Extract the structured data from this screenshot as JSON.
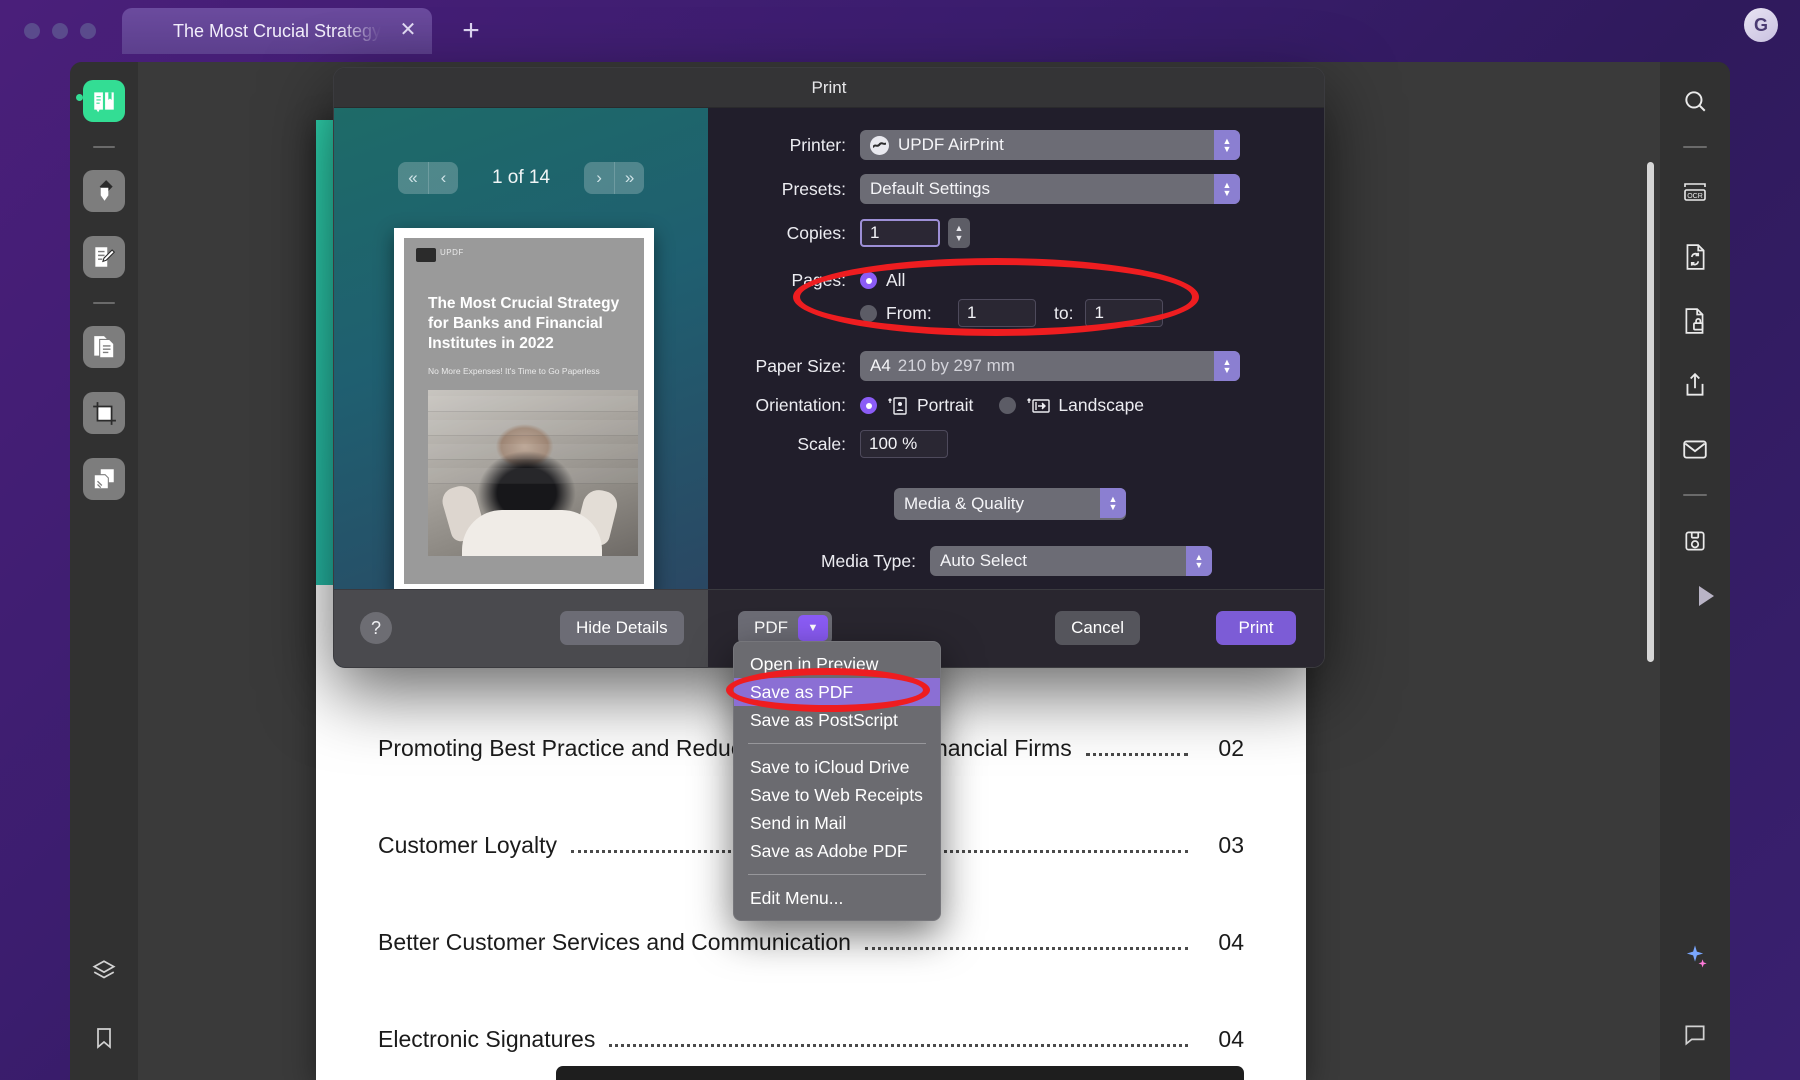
{
  "window": {
    "tab_title": "The Most Crucial Strategy",
    "close_icon": "close-icon",
    "new_tab_icon": "plus-icon",
    "avatar_initial": "G"
  },
  "left_rail": {
    "items": [
      {
        "name": "reader-tool",
        "icon": "book-reader-icon",
        "active": true
      },
      {
        "name": "highlight-tool",
        "icon": "highlighter-icon",
        "active": false
      },
      {
        "name": "edit-tool",
        "icon": "edit-document-icon",
        "active": false
      },
      {
        "name": "organize-pages-tool",
        "icon": "pages-icon",
        "active": false
      },
      {
        "name": "crop-tool",
        "icon": "crop-icon",
        "active": false
      },
      {
        "name": "batch-tool",
        "icon": "batch-pages-icon",
        "active": false
      }
    ],
    "bottom_items": [
      {
        "name": "layers-tool",
        "icon": "layers-icon"
      },
      {
        "name": "bookmark-tool",
        "icon": "bookmark-icon"
      }
    ]
  },
  "right_rail": {
    "items": [
      {
        "name": "search",
        "icon": "search-icon"
      },
      {
        "name": "ocr",
        "icon": "ocr-icon"
      },
      {
        "name": "convert",
        "icon": "convert-document-icon"
      },
      {
        "name": "protect",
        "icon": "lock-document-icon"
      },
      {
        "name": "share",
        "icon": "share-icon"
      },
      {
        "name": "mail",
        "icon": "mail-icon"
      },
      {
        "name": "save",
        "icon": "floppy-save-icon"
      }
    ],
    "bottom_items": [
      {
        "name": "ai-assistant",
        "icon": "sparkle-icon"
      },
      {
        "name": "comment",
        "icon": "comment-icon"
      }
    ],
    "expand_icon": "play-triangle-icon"
  },
  "document": {
    "hero_logo": "updf-logo-icon",
    "toc": [
      {
        "title": "Promoting Best Practice and Reducing Workload for Financial Firms",
        "page": "02"
      },
      {
        "title": "Customer Loyalty",
        "page": "03"
      },
      {
        "title": "Better Customer Services and Communication",
        "page": "04"
      },
      {
        "title": "Electronic Signatures",
        "page": "04"
      }
    ]
  },
  "print_dialog": {
    "title": "Print",
    "preview": {
      "first_icon": "«",
      "prev_icon": "‹",
      "next_icon": "›",
      "last_icon": "»",
      "page_counter": "1 of 14",
      "thumb": {
        "logo_text": "UPDF",
        "title": "The Most Crucial Strategy for Banks and Financial Institutes in 2022",
        "subtitle": "No More Expenses! It's Time to Go Paperless"
      }
    },
    "settings": {
      "printer_label": "Printer:",
      "printer_value": "UPDF AirPrint",
      "printer_icon": "airprint-icon",
      "presets_label": "Presets:",
      "presets_value": "Default Settings",
      "copies_label": "Copies:",
      "copies_value": "1",
      "pages_label": "Pages:",
      "pages_all_label": "All",
      "pages_all_selected": true,
      "pages_from_label": "From:",
      "pages_from_value": "1",
      "pages_to_label": "to:",
      "pages_to_value": "1",
      "paper_size_label": "Paper Size:",
      "paper_size_value": "A4",
      "paper_size_dimensions": "210 by 297 mm",
      "orientation_label": "Orientation:",
      "orientation_portrait_label": "Portrait",
      "orientation_landscape_label": "Landscape",
      "orientation_portrait_selected": true,
      "portrait_icon": "portrait-page-icon",
      "landscape_icon": "landscape-page-icon",
      "scale_label": "Scale:",
      "scale_value": "100 %",
      "feature_popup_value": "Media & Quality",
      "media_type_label": "Media Type:",
      "media_type_value": "Auto Select"
    },
    "footer": {
      "help_label": "?",
      "hide_details_label": "Hide Details",
      "pdf_label": "PDF",
      "cancel_label": "Cancel",
      "print_label": "Print"
    },
    "pdf_menu": {
      "items": [
        {
          "label": "Open in Preview",
          "selected": false,
          "sep_after": false
        },
        {
          "label": "Save as PDF",
          "selected": true,
          "sep_after": false
        },
        {
          "label": "Save as PostScript",
          "selected": false,
          "sep_after": true
        },
        {
          "label": "Save to iCloud Drive",
          "selected": false,
          "sep_after": false
        },
        {
          "label": "Save to Web Receipts",
          "selected": false,
          "sep_after": false
        },
        {
          "label": "Send in Mail",
          "selected": false,
          "sep_after": false
        },
        {
          "label": "Save as Adobe PDF",
          "selected": false,
          "sep_after": true
        },
        {
          "label": "Edit Menu...",
          "selected": false,
          "sep_after": false
        }
      ]
    }
  },
  "annotations": {
    "color": "#ee1d20",
    "ellipses": [
      {
        "name": "pages-section-highlight"
      },
      {
        "name": "save-as-pdf-highlight"
      }
    ]
  },
  "colors": {
    "accent_purple": "#8b5cf6",
    "accent_green": "#33dd94",
    "annotation_red": "#ee1d20",
    "dialog_bg": "#211e2b"
  }
}
